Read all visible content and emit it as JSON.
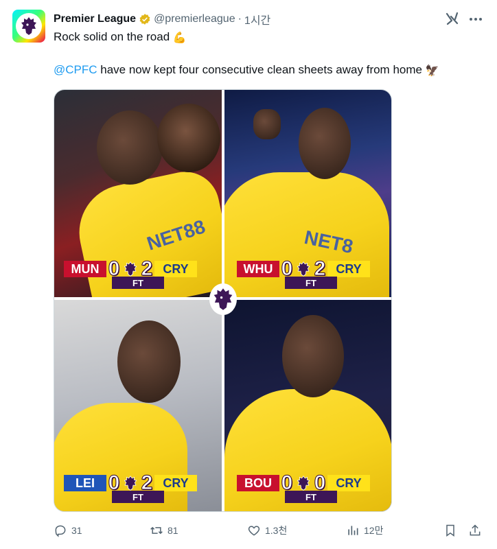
{
  "tweet": {
    "author_name": "Premier League",
    "handle": "@premierleague",
    "separator": "·",
    "time": "1시간",
    "line1": "Rock solid on the road",
    "line1_emoji": "💪",
    "mention": "@CPFC",
    "line2": " have now kept four consecutive clean sheets away from home",
    "line2_emoji": "🦅"
  },
  "media": {
    "matches": [
      {
        "home": "MUN",
        "home_score": "0",
        "away_score": "2",
        "away": "CRY",
        "status": "FT",
        "home_color": "#c8102e"
      },
      {
        "home": "WHU",
        "home_score": "0",
        "away_score": "2",
        "away": "CRY",
        "status": "FT",
        "home_color": "#c8102e"
      },
      {
        "home": "LEI",
        "home_score": "0",
        "away_score": "2",
        "away": "CRY",
        "status": "FT",
        "home_color": "#1f55b8"
      },
      {
        "home": "BOU",
        "home_score": "0",
        "away_score": "0",
        "away": "CRY",
        "status": "FT",
        "home_color": "#c8102e"
      }
    ],
    "sponsor_text": "NET88"
  },
  "actions": {
    "replies": "31",
    "reposts": "81",
    "likes": "1.3천",
    "views": "12만"
  },
  "colors": {
    "accent": "#1d9bf0",
    "secondary_text": "#536471",
    "verified_gold": "#e2b719",
    "pl_purple": "#3d1657"
  }
}
